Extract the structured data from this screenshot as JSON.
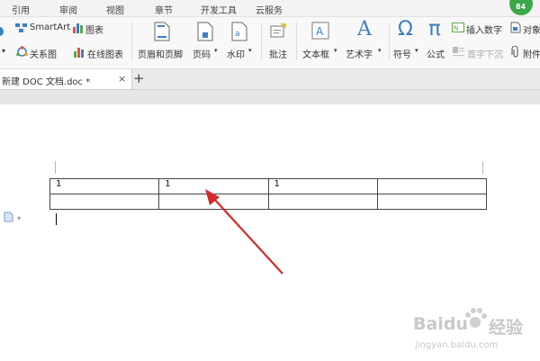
{
  "menu": {
    "items": [
      "引用",
      "审阅",
      "视图",
      "章节",
      "开发工具",
      "云服务"
    ],
    "badge": "84"
  },
  "ribbon": {
    "smartart": "SmartArt",
    "chart": "图表",
    "relation": "关系图",
    "online_chart": "在线图表",
    "header_footer": "页眉和页脚",
    "page_number": "页码",
    "watermark": "水印",
    "comment": "批注",
    "textbox": "文本框",
    "wordart": "艺术字",
    "symbol": "符号",
    "formula": "公式",
    "insert_number": "插入数字",
    "object": "对象",
    "first_sink": "首字下沉",
    "attachment": "附件",
    "symbol_glyph": "Ω",
    "formula_glyph": "π",
    "wordart_glyph": "A"
  },
  "tabs": {
    "doc_title": "新建 DOC 文档.doc *",
    "close": "×",
    "add": "+"
  },
  "table": {
    "rows": [
      [
        "1",
        "1",
        "1",
        ""
      ],
      [
        "",
        "",
        "",
        ""
      ]
    ]
  },
  "watermark": {
    "brand": "Baidu",
    "brand_cn": "经验",
    "url": "jingyan.baidu.com"
  },
  "colors": {
    "arrow": "#d42a2a",
    "badge": "#3aa84a"
  }
}
